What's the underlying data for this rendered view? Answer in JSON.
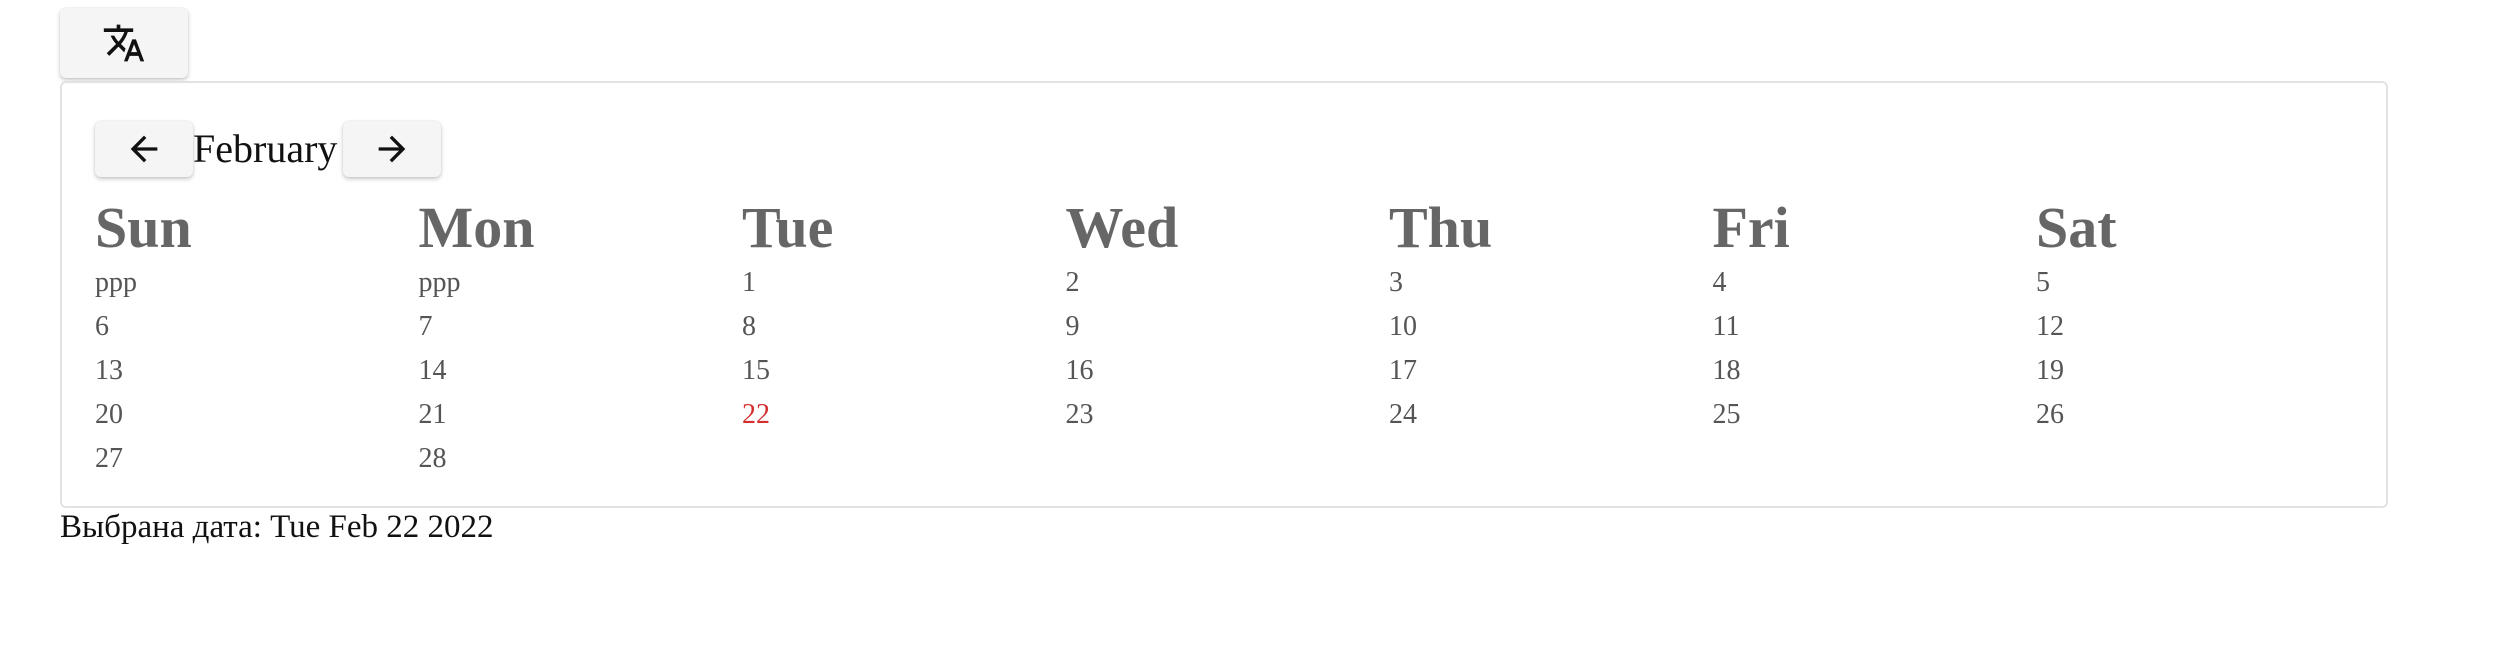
{
  "translate_button": {
    "icon": "translate-icon"
  },
  "calendar": {
    "month": "February",
    "prev_icon": "arrow-left-icon",
    "next_icon": "arrow-right-icon",
    "weekdays": [
      "Sun",
      "Mon",
      "Tue",
      "Wed",
      "Thu",
      "Fri",
      "Sat"
    ],
    "weeks": [
      [
        "ppp",
        "ppp",
        "1",
        "2",
        "3",
        "4",
        "5"
      ],
      [
        "6",
        "7",
        "8",
        "9",
        "10",
        "11",
        "12"
      ],
      [
        "13",
        "14",
        "15",
        "16",
        "17",
        "18",
        "19"
      ],
      [
        "20",
        "21",
        "22",
        "23",
        "24",
        "25",
        "26"
      ],
      [
        "27",
        "28",
        "",
        "",
        "",
        "",
        ""
      ]
    ],
    "selected_day": "22",
    "selected_color": "#d32f2f"
  },
  "selected_text": "Выбрана дата: Tue Feb 22 2022"
}
